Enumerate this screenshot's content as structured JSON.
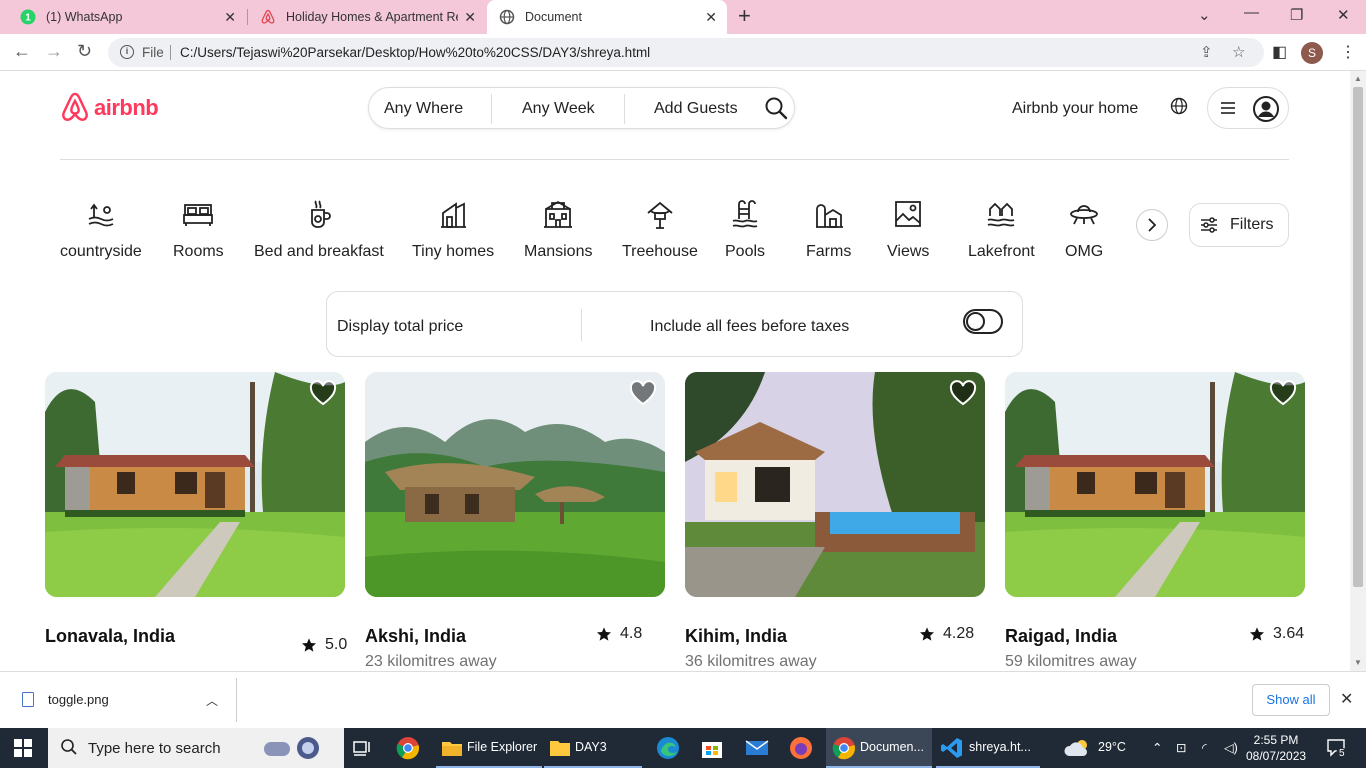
{
  "browser": {
    "tabs": [
      {
        "title": "(1) WhatsApp",
        "badge": "1"
      },
      {
        "title": "Holiday Homes & Apartment Rentals"
      },
      {
        "title": "Document"
      }
    ],
    "omnibox": {
      "scheme": "File",
      "url": "C:/Users/Tejaswi%20Parsekar/Desktop/How%20to%20CSS/DAY3/shreya.html"
    },
    "profile_initial": "S"
  },
  "header": {
    "logo": "airbnb",
    "search": {
      "where": "Any Where",
      "week": "Any Week",
      "guests": "Add Guests"
    },
    "host_link": "Airbnb your home"
  },
  "categories": [
    {
      "label": "countryside",
      "icon": "countryside-icon"
    },
    {
      "label": "Rooms",
      "icon": "bed-icon"
    },
    {
      "label": "Bed and breakfast",
      "icon": "coffee-icon"
    },
    {
      "label": "Tiny homes",
      "icon": "tiny-home-icon"
    },
    {
      "label": "Mansions",
      "icon": "mansion-icon"
    },
    {
      "label": "Treehouse",
      "icon": "treehouse-icon"
    },
    {
      "label": "Pools",
      "icon": "pool-icon"
    },
    {
      "label": "Farms",
      "icon": "farm-icon"
    },
    {
      "label": "Views",
      "icon": "views-icon"
    },
    {
      "label": "Lakefront",
      "icon": "lakefront-icon"
    },
    {
      "label": "OMG",
      "icon": "ufo-icon"
    }
  ],
  "filters_label": "Filters",
  "price_toggle": {
    "left": "Display total price",
    "right": "Include all fees before taxes",
    "on": false
  },
  "listings": [
    {
      "title": "Lonavala, India",
      "rating": "5.0",
      "distance": ""
    },
    {
      "title": "Akshi, India",
      "rating": "4.8",
      "distance": "23 kilomitres away"
    },
    {
      "title": "Kihim, India",
      "rating": "4.28",
      "distance": "36 kilomitres away"
    },
    {
      "title": "Raigad, India",
      "rating": "3.64",
      "distance": "59 kilomitres away"
    }
  ],
  "downloads": {
    "file": "toggle.png",
    "show_all": "Show all"
  },
  "taskbar": {
    "search_placeholder": "Type here to search",
    "apps": [
      {
        "label": "File Explorer"
      },
      {
        "label": "DAY3"
      },
      {
        "label": "Documen..."
      },
      {
        "label": "shreya.ht..."
      }
    ],
    "weather": "29°C",
    "time": "2:55 PM",
    "date": "08/07/2023",
    "notifications": "5"
  },
  "colors": {
    "brand": "#ff385c",
    "tabbar": "#f4c8d8",
    "taskbar": "#1f2a36"
  }
}
